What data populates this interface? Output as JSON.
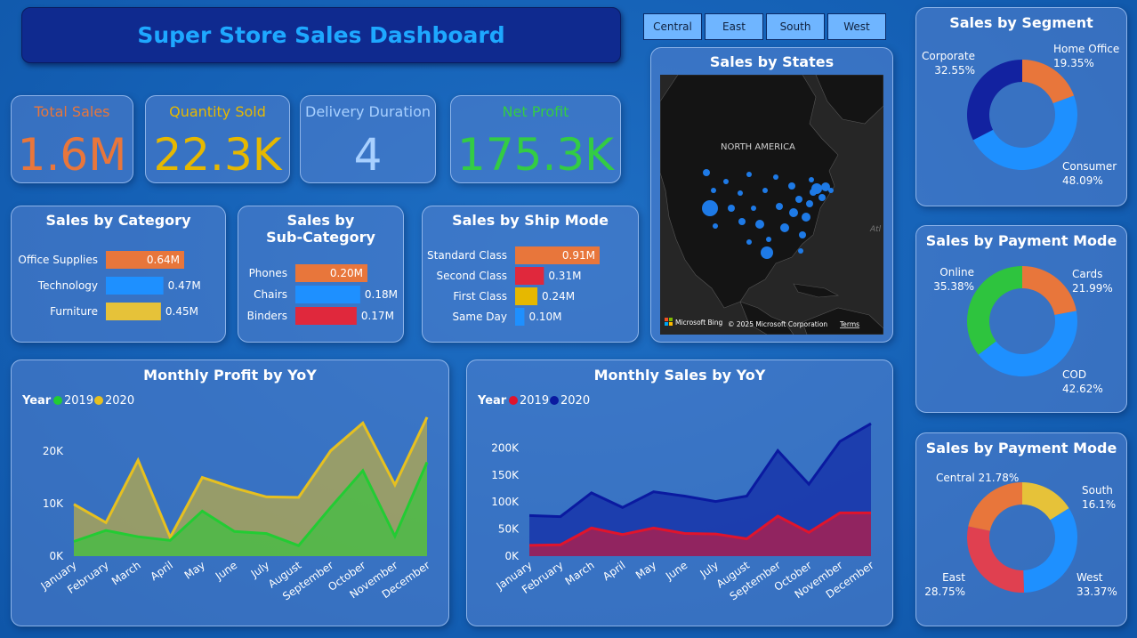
{
  "title": "Super Store Sales Dashboard",
  "regions": [
    "Central",
    "East",
    "South",
    "West"
  ],
  "kpis": [
    {
      "label": "Total Sales",
      "value": "1.6M",
      "color": "#e8763b"
    },
    {
      "label": "Quantity Sold",
      "value": "22.3K",
      "color": "#e6b800"
    },
    {
      "label": "Delivery Duration",
      "value": "4",
      "color": "#a8d0ff"
    },
    {
      "label": "Net Profit",
      "value": "175.3K",
      "color": "#33cc44"
    }
  ],
  "map": {
    "title": "Sales by States",
    "region_label": "NORTH AMERICA",
    "ocean_label": "Atl",
    "bing": "Microsoft Bing",
    "copyright": "© 2025 Microsoft Corporation",
    "terms": "Terms"
  },
  "chart_data": [
    {
      "id": "category",
      "type": "bar",
      "orientation": "horizontal",
      "title": "Sales by Category",
      "categories": [
        "Office Supplies",
        "Technology",
        "Furniture"
      ],
      "values": [
        0.64,
        0.47,
        0.45
      ],
      "labels": [
        "0.64M",
        "0.47M",
        "0.45M"
      ],
      "colors": [
        "#e8763b",
        "#1e90ff",
        "#e6c239"
      ]
    },
    {
      "id": "subcategory",
      "type": "bar",
      "orientation": "horizontal",
      "title": [
        "Sales by",
        "Sub-Category"
      ],
      "categories": [
        "Phones",
        "Chairs",
        "Binders"
      ],
      "values": [
        0.2,
        0.18,
        0.17
      ],
      "labels": [
        "0.20M",
        "0.18M",
        "0.17M"
      ],
      "colors": [
        "#e8763b",
        "#1e90ff",
        "#e0283c"
      ]
    },
    {
      "id": "shipmode",
      "type": "bar",
      "orientation": "horizontal",
      "title": "Sales by Ship Mode",
      "categories": [
        "Standard Class",
        "Second Class",
        "First Class",
        "Same Day"
      ],
      "values": [
        0.91,
        0.31,
        0.24,
        0.1
      ],
      "labels": [
        "0.91M",
        "0.31M",
        "0.24M",
        "0.10M"
      ],
      "colors": [
        "#e8763b",
        "#e0283c",
        "#e6b800",
        "#1e90ff"
      ]
    },
    {
      "id": "profit",
      "type": "area",
      "title": "Monthly Profit by YoY",
      "legend_title": "Year",
      "x": [
        "January",
        "February",
        "March",
        "April",
        "May",
        "June",
        "July",
        "August",
        "September",
        "October",
        "November",
        "December"
      ],
      "series": [
        {
          "name": "2019",
          "color": "#22cc33",
          "values": [
            2800,
            4900,
            3700,
            3000,
            8600,
            4700,
            4300,
            2000,
            9300,
            16300,
            3800,
            17900
          ]
        },
        {
          "name": "2020",
          "color": "#e6c020",
          "values": [
            9900,
            6400,
            18300,
            3600,
            15000,
            13000,
            11300,
            11200,
            20100,
            25400,
            13600,
            26500
          ]
        }
      ],
      "yticks": [
        0,
        10000,
        20000
      ],
      "ytick_labels": [
        "0K",
        "10K",
        "20K"
      ],
      "ylim": [
        0,
        28000
      ]
    },
    {
      "id": "sales",
      "type": "area",
      "title": "Monthly Sales by YoY",
      "legend_title": "Year",
      "x": [
        "January",
        "February",
        "March",
        "April",
        "May",
        "June",
        "July",
        "August",
        "September",
        "October",
        "November",
        "December"
      ],
      "series": [
        {
          "name": "2019",
          "color": "#e0142c",
          "values": [
            20000,
            21000,
            52000,
            40000,
            52000,
            42000,
            41000,
            32000,
            74000,
            44000,
            80000,
            80000
          ]
        },
        {
          "name": "2020",
          "color": "#0a1aa0",
          "values": [
            75000,
            73000,
            117000,
            90000,
            119000,
            111000,
            101000,
            111000,
            195000,
            133000,
            212000,
            245000
          ]
        }
      ],
      "yticks": [
        0,
        50000,
        100000,
        150000,
        200000
      ],
      "ytick_labels": [
        "0K",
        "50K",
        "100K",
        "150K",
        "200K"
      ],
      "ylim": [
        0,
        250000
      ]
    },
    {
      "id": "segment",
      "type": "pie",
      "donut": true,
      "title": "Sales by Segment",
      "slices": [
        {
          "label": "Home Office",
          "pct": "19.35%",
          "value": 19.35,
          "color": "#e8763b"
        },
        {
          "label": "Consumer",
          "pct": "48.09%",
          "value": 48.09,
          "color": "#1e90ff"
        },
        {
          "label": "Corporate",
          "pct": "32.55%",
          "value": 32.55,
          "color": "#1222a0"
        }
      ]
    },
    {
      "id": "payment",
      "type": "pie",
      "donut": true,
      "title": "Sales by Payment Mode",
      "slices": [
        {
          "label": "Cards",
          "pct": "21.99%",
          "value": 21.99,
          "color": "#e8763b"
        },
        {
          "label": "COD",
          "pct": "42.62%",
          "value": 42.62,
          "color": "#1e90ff"
        },
        {
          "label": "Online",
          "pct": "35.38%",
          "value": 35.38,
          "color": "#2ec43e"
        }
      ]
    },
    {
      "id": "region",
      "type": "pie",
      "donut": true,
      "title": "Sales by Payment Mode",
      "slices": [
        {
          "label": "South",
          "pct": "16.1%",
          "value": 16.1,
          "color": "#e6c239"
        },
        {
          "label": "West",
          "pct": "33.37%",
          "value": 33.37,
          "color": "#1e90ff"
        },
        {
          "label": "East",
          "pct": "28.75%",
          "value": 28.75,
          "color": "#e04050"
        },
        {
          "label": "Central",
          "pct": "21.78%",
          "value": 21.78,
          "color": "#e8763b"
        }
      ]
    }
  ]
}
